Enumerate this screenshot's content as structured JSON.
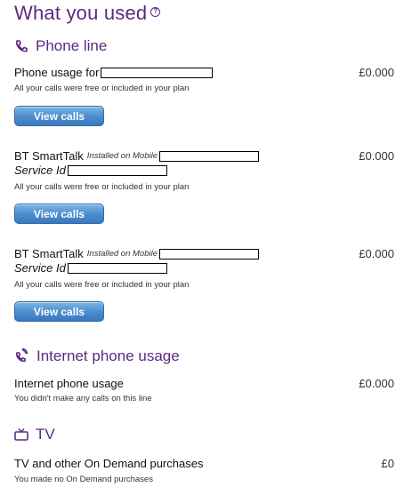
{
  "page": {
    "title": "What you used",
    "help_icon": "question-circle-icon"
  },
  "accent_color": "#5a2a82",
  "sections": {
    "phone_line": {
      "title": "Phone line",
      "icon": "phone-handset-icon",
      "items": [
        {
          "title": "Phone usage for",
          "subtitle": "All your calls were free or included in your plan",
          "amount": "£0.000",
          "button": "View calls"
        },
        {
          "title": "BT SmartTalk",
          "tag": "Installed on Mobile",
          "service_label": "Service Id",
          "subtitle": "All your calls were free or included in your plan",
          "amount": "£0.000",
          "button": "View calls"
        },
        {
          "title": "BT SmartTalk",
          "tag": "Installed on Mobile",
          "service_label": "Service Id",
          "subtitle": "All your calls were free or included in your plan",
          "amount": "£0.000",
          "button": "View calls"
        }
      ]
    },
    "internet_phone": {
      "title": "Internet phone usage",
      "icon": "internet-phone-icon",
      "item": {
        "title": "Internet phone usage",
        "subtitle": "You didn't make any calls on this line",
        "amount": "£0.000"
      }
    },
    "tv": {
      "title": "TV",
      "icon": "tv-icon",
      "item": {
        "title": "TV and other On Demand purchases",
        "subtitle": "You made no On Demand purchases",
        "amount": "£0"
      }
    }
  }
}
